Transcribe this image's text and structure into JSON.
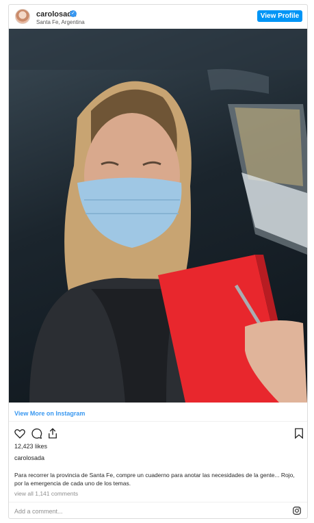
{
  "header": {
    "username": "carolosada",
    "verified_mark": "✓",
    "location": "Santa Fe, Argentina",
    "view_profile_label": "View Profile"
  },
  "links": {
    "view_more": "View More on Instagram"
  },
  "actions": {
    "icons": [
      "heart-icon",
      "comment-icon",
      "share-icon",
      "bookmark-icon"
    ]
  },
  "post": {
    "likes": "12,423 likes",
    "owner": "carolosada",
    "caption": "Para recorrer la provincia de Santa Fe, compre un cuaderno para anotar las necesidades de la gente... Rojo, por la emergencia de cada uno de los temas.",
    "comments_link": "view all 1,141 comments"
  },
  "comment_bar": {
    "placeholder": "Add a comment..."
  },
  "colors": {
    "accent": "#0095f6",
    "link": "#3897f0",
    "notebook": "#e8272d"
  }
}
